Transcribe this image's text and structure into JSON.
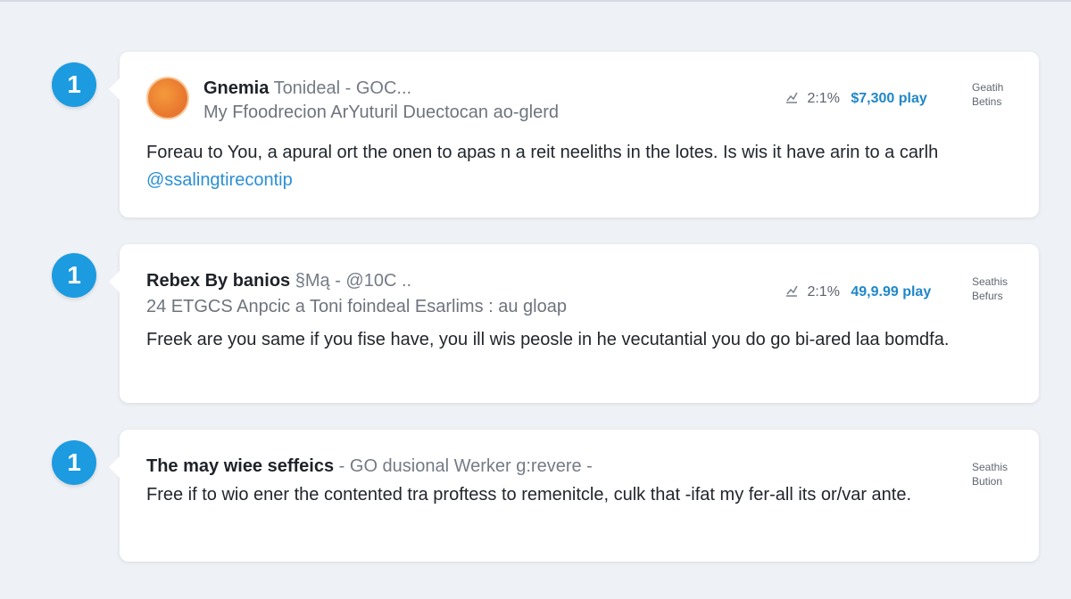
{
  "feed": {
    "items": [
      {
        "badge": "1",
        "author": "Gnemia",
        "handle": "Tonideal - GOC...",
        "subtitle": "My Ffoodrecion ArYuturil Duectocan ao-glerd",
        "body_text": "Foreau to You, a apural ort the onen to apas n a reit neeliths in the lotes. Is wis it have arin to a carlh",
        "mention": "@ssalingtirecontip",
        "stat_ratio": "2:1%",
        "stat_value": "$7,300 play",
        "side_line1": "Geatih",
        "side_line2": "Betins"
      },
      {
        "badge": "1",
        "author": "Rebex By banios",
        "handle": "§Mą - @10C ..",
        "subtitle": "24 ETGCS Anpcic a Toni foindeal Esarlims : au gloap",
        "body_text": "Freek are you same if you fise have, you ill wis peosle in he vecutantial you do go bi-ared laa bomdfa.",
        "stat_ratio": "2:1%",
        "stat_value": "49,9.99 play",
        "side_line1": "Seathis",
        "side_line2": "Befurs"
      },
      {
        "badge": "1",
        "author": "The may wiee seffeics",
        "handle": "- GO dusional Werker g:revere -",
        "body_text": "Free if to wio ener the contented tra proftess to remenitcle, culk that -ifat my fer-all its or/var ante.",
        "side_line1": "Seathis",
        "side_line2": "Bution"
      }
    ]
  },
  "colors": {
    "badge": "#1c9be0",
    "price": "#1f87c9",
    "mention": "#2a8fd4",
    "avatar": "#ea7a30",
    "background": "#eef1f5"
  },
  "icons": {
    "stats": "trend-chart-icon"
  }
}
